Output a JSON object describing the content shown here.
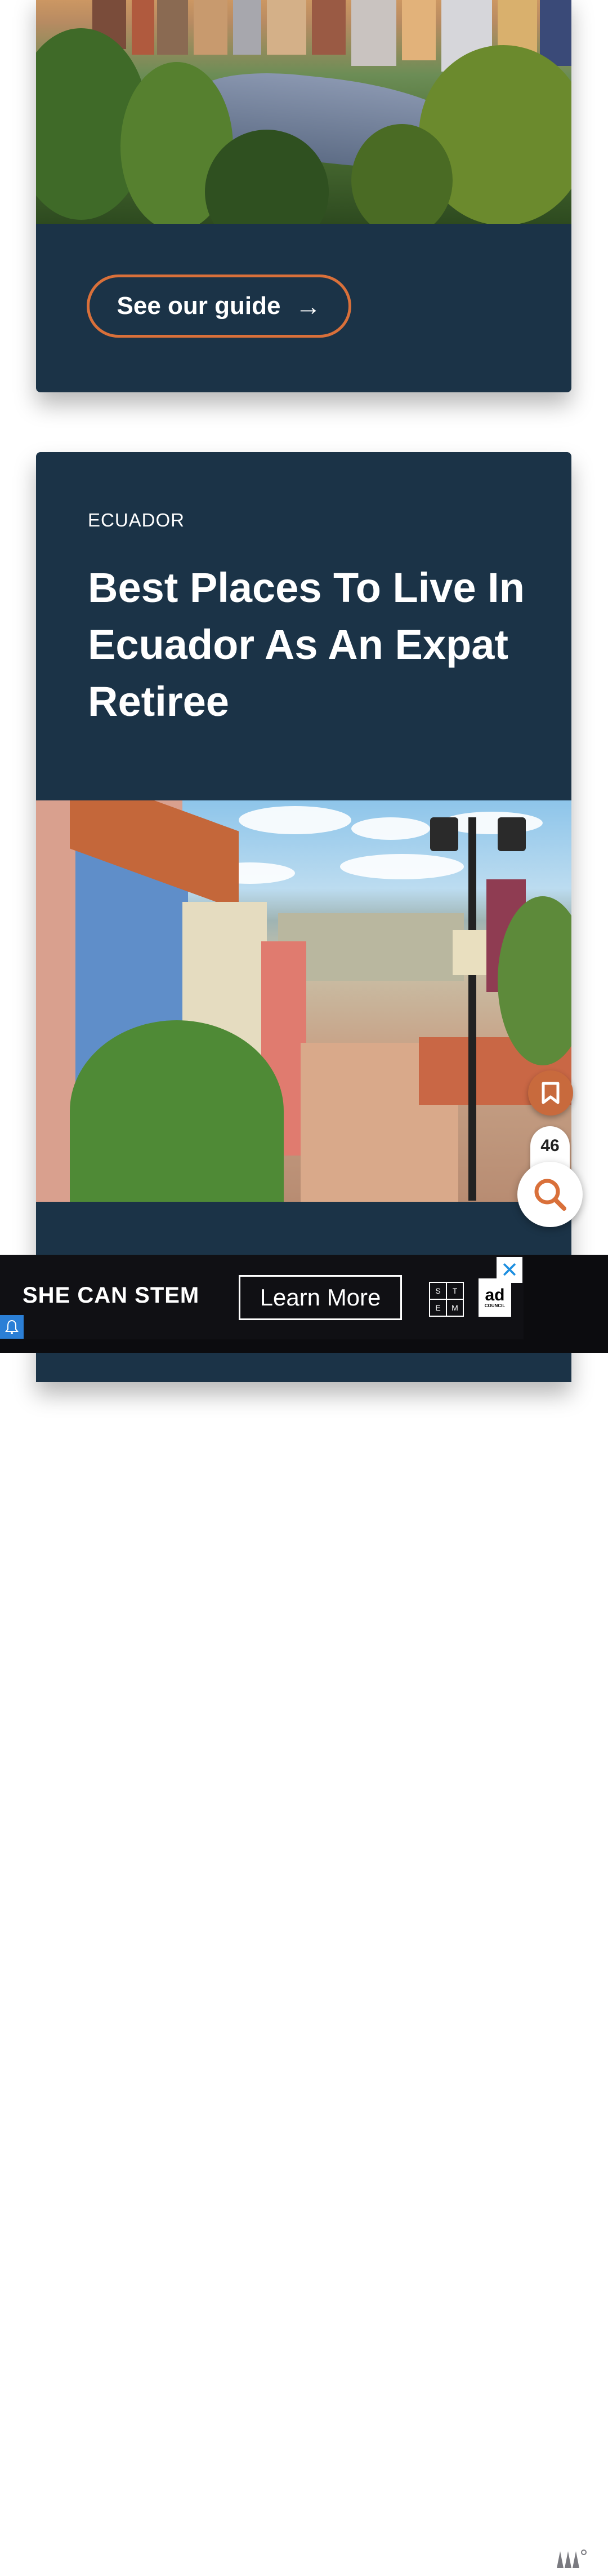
{
  "card1": {
    "guide_label": "See our guide",
    "arrow": "→"
  },
  "card2": {
    "country": "ECUADOR",
    "title": "Best Places To Live In Ecuador As An Expat Retiree"
  },
  "floating": {
    "bookmark_icon": "bookmark-icon",
    "saved_count": "46",
    "search_icon": "search-icon"
  },
  "ad": {
    "headline": "SHE CAN STEM",
    "cta": "Learn More",
    "stem_letters": [
      "S",
      "T",
      "E",
      "M"
    ],
    "council_logo": "ad",
    "council_sub": "COUNCIL",
    "close": "✕"
  },
  "colors": {
    "card_bg": "#1b3347",
    "accent": "#d9703a",
    "bookmark_bg": "#c86a3d"
  }
}
